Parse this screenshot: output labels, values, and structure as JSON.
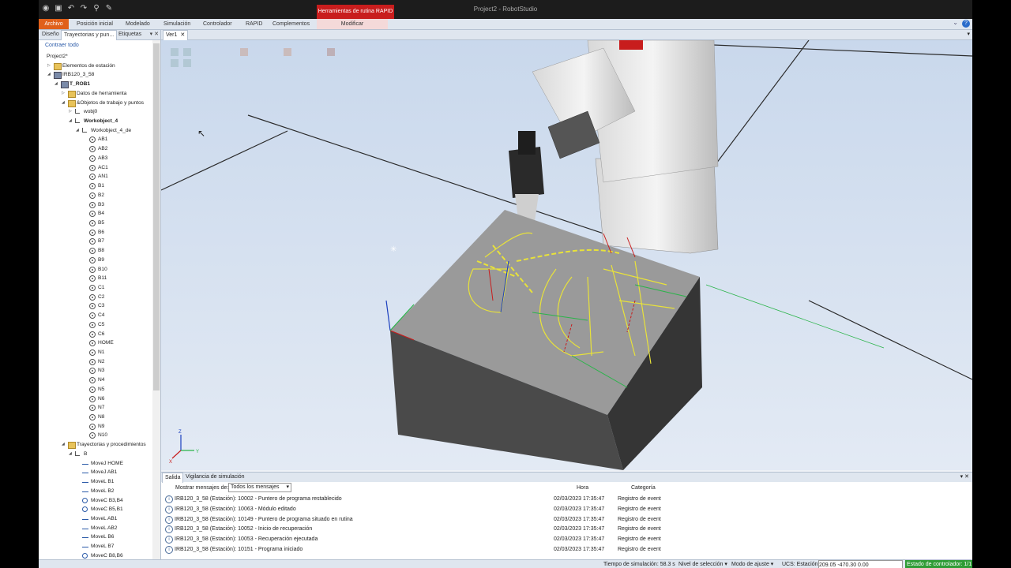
{
  "window": {
    "title": "Project2 - RobotStudio",
    "context_tab": "Herramientas de rutina RAPID"
  },
  "ribbon": {
    "tabs": [
      "Archivo",
      "Posición inicial",
      "Modelado",
      "Simulación",
      "Controlador",
      "RAPID",
      "Complementos",
      "Modificar"
    ]
  },
  "left_panel": {
    "tabs": [
      "Diseño",
      "Trayectorias y pun...",
      "Etiquetas"
    ],
    "collapse_all": "Contraer todo",
    "tree": [
      {
        "label": "Project2*",
        "indent": 0,
        "icon": "project",
        "twisty": "",
        "bold": false
      },
      {
        "label": "Elementos de estación",
        "indent": 1,
        "icon": "folder",
        "twisty": "▷",
        "bold": false
      },
      {
        "label": "IRB120_3_58",
        "indent": 1,
        "icon": "robot",
        "twisty": "◢",
        "bold": false
      },
      {
        "label": "T_ROB1",
        "indent": 2,
        "icon": "robot",
        "twisty": "◢",
        "bold": true
      },
      {
        "label": "Datos de herramienta",
        "indent": 3,
        "icon": "folder",
        "twisty": "▷",
        "bold": false
      },
      {
        "label": "&Objetos de trabajo y puntos",
        "indent": 3,
        "icon": "folder",
        "twisty": "◢",
        "bold": false
      },
      {
        "label": "wobj0",
        "indent": 4,
        "icon": "wobj",
        "twisty": "▷",
        "bold": false
      },
      {
        "label": "Workobject_4",
        "indent": 4,
        "icon": "wobj",
        "twisty": "◢",
        "bold": true
      },
      {
        "label": "Workobject_4_de",
        "indent": 5,
        "icon": "wobj",
        "twisty": "◢",
        "bold": false
      },
      {
        "label": "AB1",
        "indent": 6,
        "icon": "target",
        "twisty": "",
        "bold": false
      },
      {
        "label": "AB2",
        "indent": 6,
        "icon": "target",
        "twisty": "",
        "bold": false
      },
      {
        "label": "AB3",
        "indent": 6,
        "icon": "target",
        "twisty": "",
        "bold": false
      },
      {
        "label": "AC1",
        "indent": 6,
        "icon": "target",
        "twisty": "",
        "bold": false
      },
      {
        "label": "AN1",
        "indent": 6,
        "icon": "target",
        "twisty": "",
        "bold": false
      },
      {
        "label": "B1",
        "indent": 6,
        "icon": "target",
        "twisty": "",
        "bold": false
      },
      {
        "label": "B2",
        "indent": 6,
        "icon": "target",
        "twisty": "",
        "bold": false
      },
      {
        "label": "B3",
        "indent": 6,
        "icon": "target",
        "twisty": "",
        "bold": false
      },
      {
        "label": "B4",
        "indent": 6,
        "icon": "target",
        "twisty": "",
        "bold": false
      },
      {
        "label": "B5",
        "indent": 6,
        "icon": "target",
        "twisty": "",
        "bold": false
      },
      {
        "label": "B6",
        "indent": 6,
        "icon": "target",
        "twisty": "",
        "bold": false
      },
      {
        "label": "B7",
        "indent": 6,
        "icon": "target",
        "twisty": "",
        "bold": false
      },
      {
        "label": "B8",
        "indent": 6,
        "icon": "target",
        "twisty": "",
        "bold": false
      },
      {
        "label": "B9",
        "indent": 6,
        "icon": "target",
        "twisty": "",
        "bold": false
      },
      {
        "label": "B10",
        "indent": 6,
        "icon": "target",
        "twisty": "",
        "bold": false
      },
      {
        "label": "B11",
        "indent": 6,
        "icon": "target",
        "twisty": "",
        "bold": false
      },
      {
        "label": "C1",
        "indent": 6,
        "icon": "target",
        "twisty": "",
        "bold": false
      },
      {
        "label": "C2",
        "indent": 6,
        "icon": "target",
        "twisty": "",
        "bold": false
      },
      {
        "label": "C3",
        "indent": 6,
        "icon": "target",
        "twisty": "",
        "bold": false
      },
      {
        "label": "C4",
        "indent": 6,
        "icon": "target",
        "twisty": "",
        "bold": false
      },
      {
        "label": "C5",
        "indent": 6,
        "icon": "target",
        "twisty": "",
        "bold": false
      },
      {
        "label": "C6",
        "indent": 6,
        "icon": "target",
        "twisty": "",
        "bold": false
      },
      {
        "label": "HOME",
        "indent": 6,
        "icon": "target",
        "twisty": "",
        "bold": false
      },
      {
        "label": "N1",
        "indent": 6,
        "icon": "target",
        "twisty": "",
        "bold": false
      },
      {
        "label": "N2",
        "indent": 6,
        "icon": "target",
        "twisty": "",
        "bold": false
      },
      {
        "label": "N3",
        "indent": 6,
        "icon": "target",
        "twisty": "",
        "bold": false
      },
      {
        "label": "N4",
        "indent": 6,
        "icon": "target",
        "twisty": "",
        "bold": false
      },
      {
        "label": "N5",
        "indent": 6,
        "icon": "target",
        "twisty": "",
        "bold": false
      },
      {
        "label": "N6",
        "indent": 6,
        "icon": "target",
        "twisty": "",
        "bold": false
      },
      {
        "label": "N7",
        "indent": 6,
        "icon": "target",
        "twisty": "",
        "bold": false
      },
      {
        "label": "N8",
        "indent": 6,
        "icon": "target",
        "twisty": "",
        "bold": false
      },
      {
        "label": "N9",
        "indent": 6,
        "icon": "target",
        "twisty": "",
        "bold": false
      },
      {
        "label": "N10",
        "indent": 6,
        "icon": "target",
        "twisty": "",
        "bold": false
      },
      {
        "label": "Trayectorias y procedimientos",
        "indent": 3,
        "icon": "folder",
        "twisty": "◢",
        "bold": false
      },
      {
        "label": "B",
        "indent": 4,
        "icon": "path",
        "twisty": "◢",
        "bold": false
      },
      {
        "label": "MoveJ HOME",
        "indent": 5,
        "icon": "move",
        "twisty": "",
        "bold": false
      },
      {
        "label": "MoveJ AB1",
        "indent": 5,
        "icon": "move",
        "twisty": "",
        "bold": false
      },
      {
        "label": "MoveL B1",
        "indent": 5,
        "icon": "move",
        "twisty": "",
        "bold": false
      },
      {
        "label": "MoveL B2",
        "indent": 5,
        "icon": "move",
        "twisty": "",
        "bold": false
      },
      {
        "label": "MoveC B3,B4",
        "indent": 5,
        "icon": "circ",
        "twisty": "",
        "bold": false
      },
      {
        "label": "MoveC B5,B1",
        "indent": 5,
        "icon": "circ",
        "twisty": "",
        "bold": false
      },
      {
        "label": "MoveL AB1",
        "indent": 5,
        "icon": "move",
        "twisty": "",
        "bold": false
      },
      {
        "label": "MoveL AB2",
        "indent": 5,
        "icon": "move",
        "twisty": "",
        "bold": false
      },
      {
        "label": "MoveL B6",
        "indent": 5,
        "icon": "move",
        "twisty": "",
        "bold": false
      },
      {
        "label": "MoveL B7",
        "indent": 5,
        "icon": "move",
        "twisty": "",
        "bold": false
      },
      {
        "label": "MoveC B8,B6",
        "indent": 5,
        "icon": "circ",
        "twisty": "",
        "bold": false
      }
    ]
  },
  "view": {
    "tab": "Ver1"
  },
  "output": {
    "tabs": [
      "Salida",
      "Vigilancia de simulación"
    ],
    "filter_label": "Mostrar mensajes de:",
    "filter_value": "Todos los mensajes",
    "col_time": "Hora",
    "col_category": "Categoría",
    "rows": [
      {
        "msg": "IRB120_3_58 (Estación): 10002 - Puntero de programa restablecido",
        "time": "02/03/2023 17:35:47",
        "cat": "Registro de event"
      },
      {
        "msg": "IRB120_3_58 (Estación): 10063 - Módulo editado",
        "time": "02/03/2023 17:35:47",
        "cat": "Registro de event"
      },
      {
        "msg": "IRB120_3_58 (Estación): 10149 - Puntero de programa situado en rutina",
        "time": "02/03/2023 17:35:47",
        "cat": "Registro de event"
      },
      {
        "msg": "IRB120_3_58 (Estación): 10052 - Inicio de recuperación",
        "time": "02/03/2023 17:35:47",
        "cat": "Registro de event"
      },
      {
        "msg": "IRB120_3_58 (Estación): 10053 - Recuperación ejecutada",
        "time": "02/03/2023 17:35:47",
        "cat": "Registro de event"
      },
      {
        "msg": "IRB120_3_58 (Estación): 10151 - Programa iniciado",
        "time": "02/03/2023 17:35:47",
        "cat": "Registro de event"
      }
    ]
  },
  "statusbar": {
    "sim_time": "Tiempo de simulación: 58.3 s",
    "selection_level": "Nivel de selección ▾",
    "snap_mode": "Modo de ajuste ▾",
    "ucs": "UCS: Estación",
    "coords": "209.05  -470.30  0.00",
    "controller_state": "Estado de controlador: 1/1"
  },
  "colors": {
    "accent": "#e0601a",
    "context": "#c81d1d",
    "status_ok": "#2f9c36",
    "path": "#f2e600"
  }
}
